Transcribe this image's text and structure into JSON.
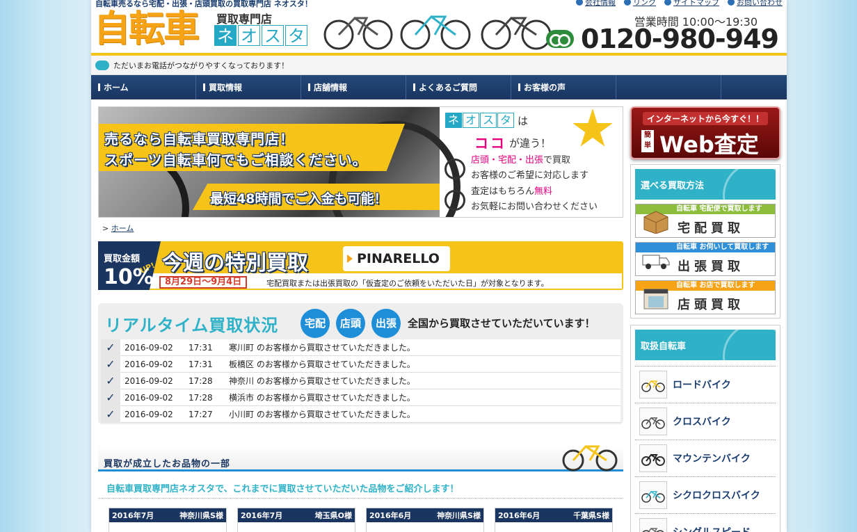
{
  "header": {
    "tagline": "自転車売るなら宅配・出張・店頭買取の買取専門店 ネオスタ！",
    "logo_main": "自転車",
    "logo_sub": "買取専門店",
    "logo_neo": [
      "ネ",
      "オ",
      "ス",
      "タ"
    ],
    "top_links": [
      "会社情報",
      "リンク",
      "サイトマップ",
      "お問い合わせ"
    ],
    "hours": "営業時間 10:00～19:30",
    "phone": "0120-980-949"
  },
  "notice": "ただいまお電話がつながりやすくなっております！",
  "nav": [
    "ホーム",
    "買取情報",
    "店舗情報",
    "よくあるご質問",
    "お客様の声",
    ""
  ],
  "hero": {
    "line1": "売るなら自転車買取専門店！",
    "line2": "スポーツ自転車何でもご相談ください。",
    "line3": "最短48時間でご入金も可能！",
    "neo": [
      "ネ",
      "オ",
      "ス",
      "タ"
    ],
    "ha": "は",
    "koko": "ココ",
    "chigau": "が違う！",
    "feat1_a": "店頭・宅配・出張",
    "feat1_b": "で買取",
    "feat1_c": "お客様のご希望に対応します",
    "feat2_a": "査定はもちろん",
    "feat2_b": "無料",
    "feat2_c": "お気軽にお問い合わせください"
  },
  "breadcrumb": {
    "sep": ">",
    "home": "ホーム"
  },
  "special": {
    "badge_label": "買取金額",
    "badge_up": "UP!",
    "badge_pct": "10%",
    "title": "今週の特別買取",
    "brand": "PINARELLO",
    "dates": "8月29日～9月4日",
    "condition": "宅配買取または出張買取の「仮査定のご依頼をいただいた日」が対象となります。"
  },
  "realtime": {
    "title": "リアルタイム買取状況",
    "methods": [
      "宅配",
      "店頭",
      "出張"
    ],
    "note": "全国から買取させていただいています！",
    "rows": [
      {
        "date": "2016-09-02",
        "time": "17:31",
        "text": "寒川町 のお客様から買取させていただきました。"
      },
      {
        "date": "2016-09-02",
        "time": "17:31",
        "text": "板橋区 のお客様から買取させていただきました。"
      },
      {
        "date": "2016-09-02",
        "time": "17:28",
        "text": "神奈川 のお客様から買取させていただきました。"
      },
      {
        "date": "2016-09-02",
        "time": "17:28",
        "text": "横浜市 のお客様から買取させていただきました。"
      },
      {
        "date": "2016-09-02",
        "time": "17:27",
        "text": "小川町 のお客様から買取させていただきました。"
      }
    ]
  },
  "items": {
    "heading": "買取が成立したお品物の一部",
    "intro": "自転車買取専門店ネオスタで、これまでに買取させていただいた品物をご紹介します！",
    "cards": [
      {
        "month": "2016年7月",
        "who": "神奈川県S様"
      },
      {
        "month": "2016年7月",
        "who": "埼玉県O様"
      },
      {
        "month": "2016年6月",
        "who": "神奈川県S様"
      },
      {
        "month": "2016年6月",
        "who": "千葉県S様"
      }
    ]
  },
  "sidebar": {
    "web_small": "インターネットから今すぐ！！",
    "web_kan": "簡単",
    "web_big": "Web査定",
    "methods_head": "選べる買取方法",
    "methods": [
      {
        "strip": "自転車 宅配便で買取します",
        "label": "宅配買取",
        "color": "#8cbd3c"
      },
      {
        "strip": "自転車 お伺いして買取します",
        "label": "出張買取",
        "color": "#2f8fd8"
      },
      {
        "strip": "自転車 お店で買取します",
        "label": "店頭買取",
        "color": "#f6a316"
      }
    ],
    "bikes_head": "取扱自転車",
    "bikes": [
      "ロードバイク",
      "クロスバイク",
      "マウンテンバイク",
      "シクロクロスバイク",
      "シングルスピード"
    ]
  }
}
